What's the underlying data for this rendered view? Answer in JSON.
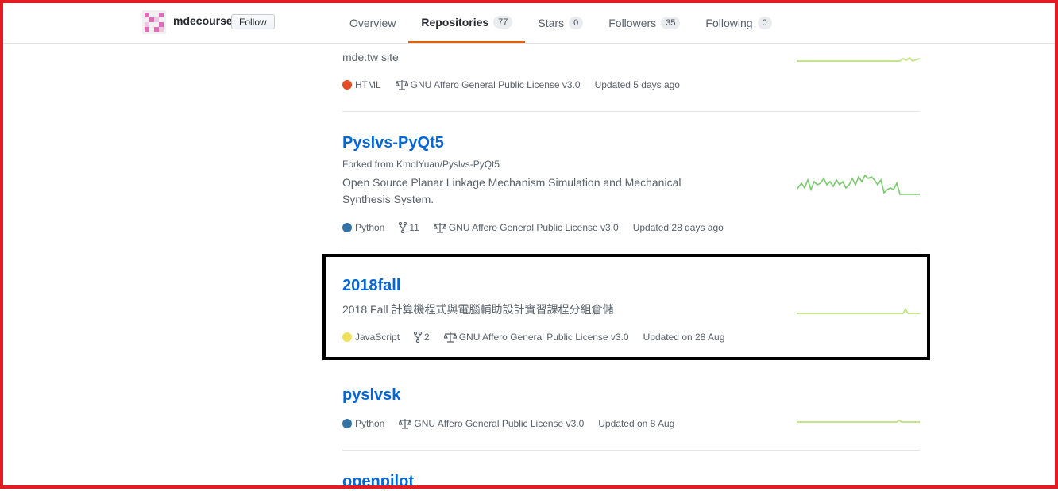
{
  "profile": {
    "username": "mdecourse",
    "follow_label": "Follow"
  },
  "tabs": [
    {
      "label": "Overview",
      "count": ""
    },
    {
      "label": "Repositories",
      "count": "77",
      "selected": true
    },
    {
      "label": "Stars",
      "count": "0"
    },
    {
      "label": "Followers",
      "count": "35"
    },
    {
      "label": "Following",
      "count": "0"
    }
  ],
  "repos": [
    {
      "description": "mde.tw site",
      "language": "HTML",
      "language_color": "#e34c26",
      "license": "GNU Affero General Public License v3.0",
      "updated": "Updated 5 days ago"
    },
    {
      "name": "Pyslvs-PyQt5",
      "forked_from": "Forked from KmolYuan/Pyslvs-PyQt5",
      "description": "Open Source Planar Linkage Mechanism Simulation and Mechanical Synthesis System.",
      "language": "Python",
      "language_color": "#3572A5",
      "forks": "11",
      "license": "GNU Affero General Public License v3.0",
      "updated": "Updated 28 days ago"
    },
    {
      "name": "2018fall",
      "description": "2018 Fall 計算機程式與電腦輔助設計實習課程分組倉儲",
      "language": "JavaScript",
      "language_color": "#f1e05a",
      "forks": "2",
      "license": "GNU Affero General Public License v3.0",
      "updated": "Updated on 28 Aug"
    },
    {
      "name": "pyslvsk",
      "language": "Python",
      "language_color": "#3572A5",
      "license": "GNU Affero General Public License v3.0",
      "updated": "Updated on 8 Aug"
    },
    {
      "name": "openpilot"
    }
  ]
}
